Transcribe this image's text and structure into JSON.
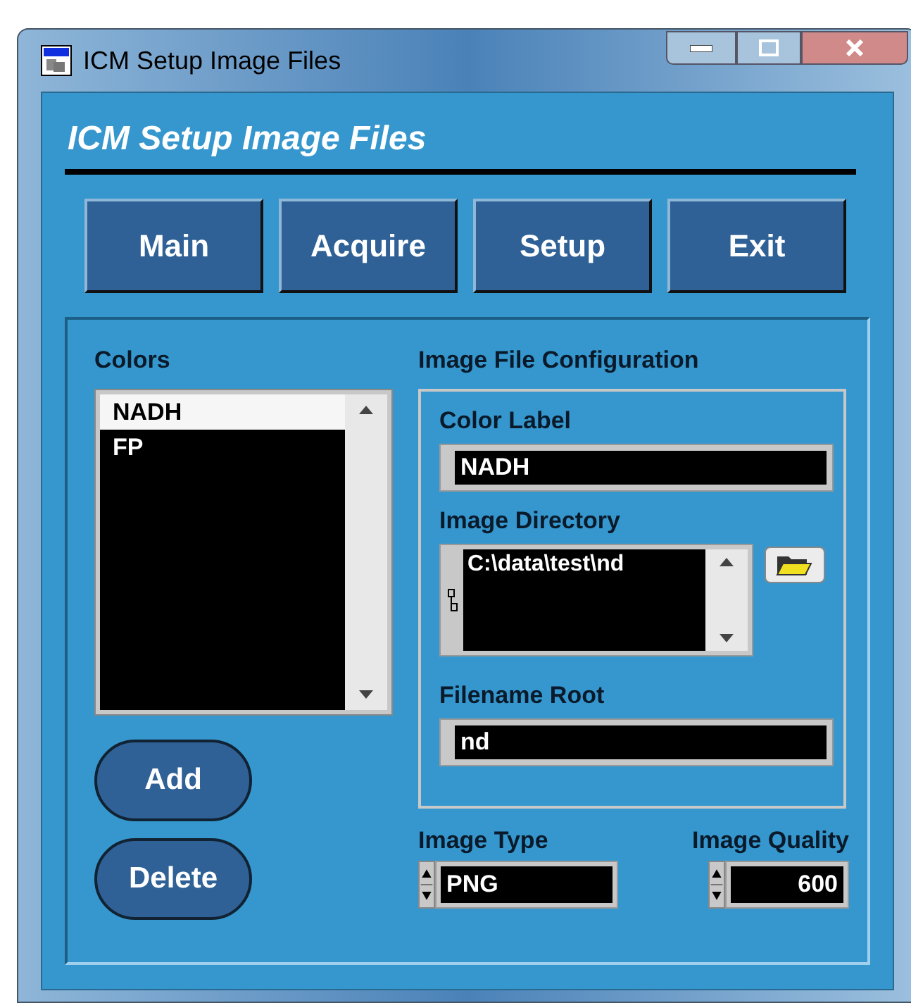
{
  "window": {
    "title": "ICM Setup Image Files"
  },
  "heading": "ICM Setup Image Files",
  "nav_buttons": [
    "Main",
    "Acquire",
    "Setup",
    "Exit"
  ],
  "colors": {
    "label": "Colors",
    "items": [
      {
        "label": "NADH",
        "selected": true
      },
      {
        "label": "FP",
        "selected": false
      }
    ]
  },
  "actions": [
    "Add",
    "Delete"
  ],
  "config": {
    "title": "Image File Configuration",
    "color_label": {
      "label": "Color Label",
      "value": "NADH"
    },
    "image_directory": {
      "label": "Image Directory",
      "value": "C:\\data\\test\\nd"
    },
    "filename_root": {
      "label": "Filename Root",
      "value": "nd"
    }
  },
  "image_type": {
    "label": "Image Type",
    "value": "PNG"
  },
  "image_quality": {
    "label": "Image Quality",
    "value": "600"
  }
}
